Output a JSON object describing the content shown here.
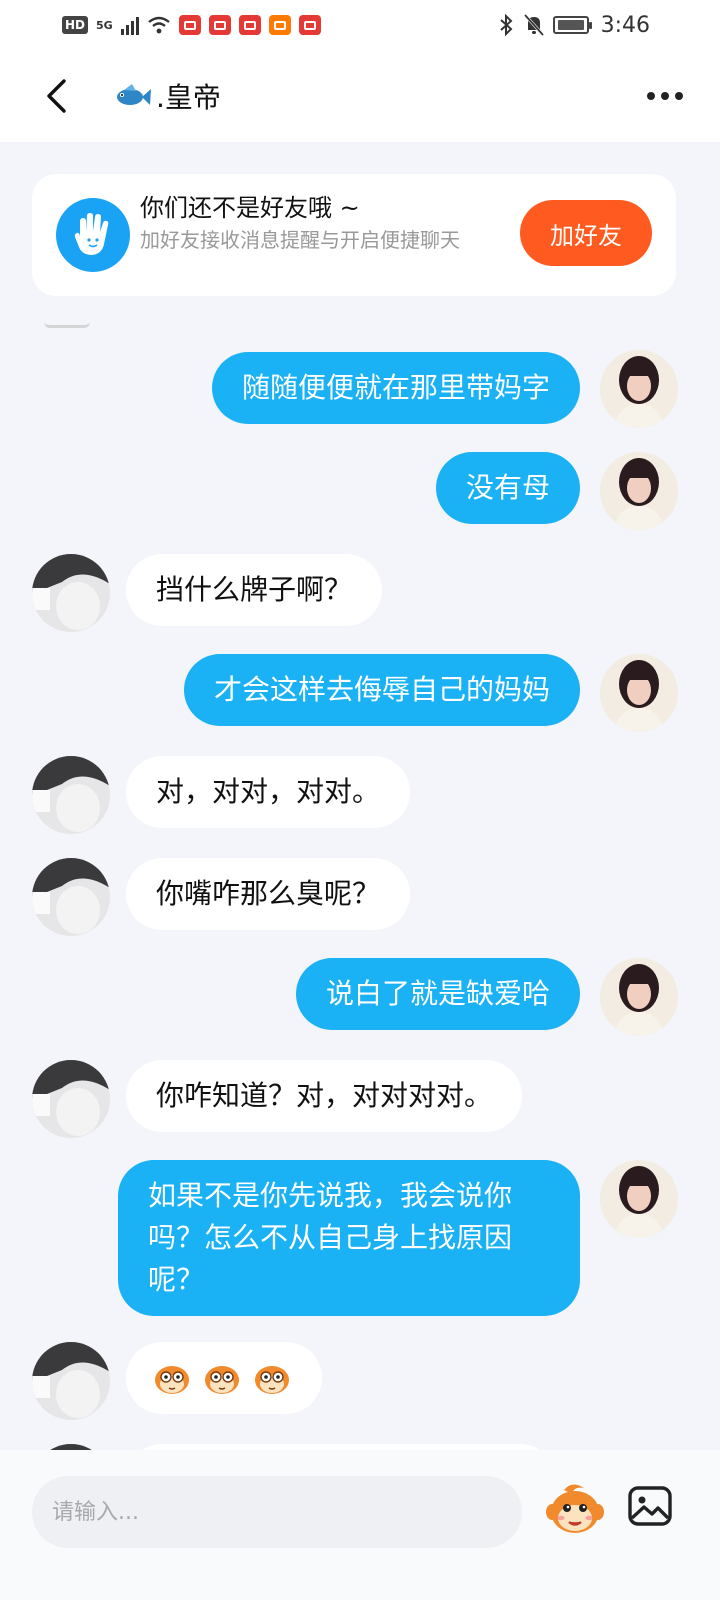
{
  "status_bar": {
    "time": "3:46",
    "hd": "HD",
    "network": "5G"
  },
  "header": {
    "title": ".皇帝"
  },
  "banner": {
    "title": "你们还不是好友哦 ~",
    "subtitle": "加好友接收消息提醒与开启便捷聊天",
    "add_button": "加好友"
  },
  "messages": [
    {
      "from": "me",
      "text": "随随便便就在那里带妈字"
    },
    {
      "from": "me",
      "text": "没有母"
    },
    {
      "from": "them",
      "text": "挡什么牌子啊？"
    },
    {
      "from": "me",
      "text": "才会这样去侮辱自己的妈妈"
    },
    {
      "from": "them",
      "text": "对，对对，对对。"
    },
    {
      "from": "them",
      "text": "你嘴咋那么臭呢？"
    },
    {
      "from": "me",
      "text": "说白了就是缺爱哈"
    },
    {
      "from": "them",
      "text": "你咋知道？对，对对对对。"
    },
    {
      "from": "me",
      "text": "如果不是你先说我，我会说你吗？怎么不从自己身上找原因呢？"
    },
    {
      "from": "them",
      "text": "",
      "emoji_count": 3
    }
  ],
  "input": {
    "placeholder": "请输入..."
  },
  "colors": {
    "accent": "#1ab1f5",
    "add_button": "#ff5a1f",
    "banner_icon": "#1aa3f4"
  }
}
